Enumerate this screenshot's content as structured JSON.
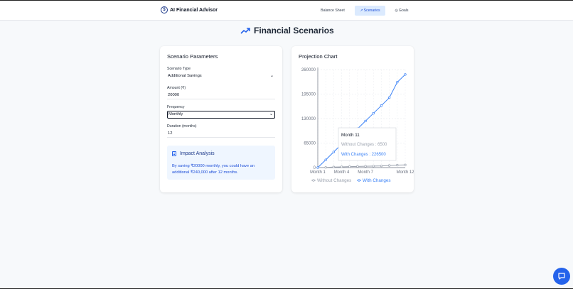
{
  "nav": {
    "brand": "AI Financial Advisor",
    "links": [
      "Balance Sheet",
      "Scenarios",
      "Goals"
    ]
  },
  "page": {
    "title": "Financial Scenarios"
  },
  "params": {
    "title": "Scenario Parameters",
    "type_label": "Scenario Type",
    "type_value": "Additional Savings",
    "amount_label": "Amount (₹)",
    "amount_value": "20000",
    "freq_label": "Frequency",
    "freq_value": "Monthly",
    "duration_label": "Duration (months)",
    "duration_value": "12"
  },
  "impact": {
    "title": "Impact Analysis",
    "text": "By saving ₹20000 monthly, you could have an additional ₹240,000 after 12 months."
  },
  "chart": {
    "title": "Projection Chart",
    "tooltip": {
      "month": "Month 11",
      "without": "Without Changes : 6500",
      "with": "With Changes : 226500"
    }
  },
  "colors": {
    "accent": "#2563eb",
    "without": "#9ca3af",
    "with": "#3b82f6"
  },
  "chart_data": {
    "type": "line",
    "title": "Projection Chart",
    "x": [
      "Month 1",
      "Month 2",
      "Month 3",
      "Month 4",
      "Month 5",
      "Month 6",
      "Month 7",
      "Month 8",
      "Month 9",
      "Month 10",
      "Month 11",
      "Month 12"
    ],
    "xticks": [
      "Month 1",
      "Month 4",
      "Month 7",
      "Month 12"
    ],
    "yticks": [
      0,
      65000,
      130000,
      195000,
      260000
    ],
    "ylim": [
      0,
      260000
    ],
    "grid": true,
    "legend": "bottom",
    "series": [
      {
        "name": "Without Changes",
        "values": [
          0,
          500,
          1500,
          2000,
          2500,
          3000,
          3500,
          4000,
          4500,
          5500,
          6500,
          7000
        ]
      },
      {
        "name": "With Changes",
        "values": [
          0,
          20500,
          41500,
          62000,
          82500,
          103000,
          123500,
          144000,
          164500,
          185500,
          226500,
          247000
        ]
      }
    ]
  }
}
